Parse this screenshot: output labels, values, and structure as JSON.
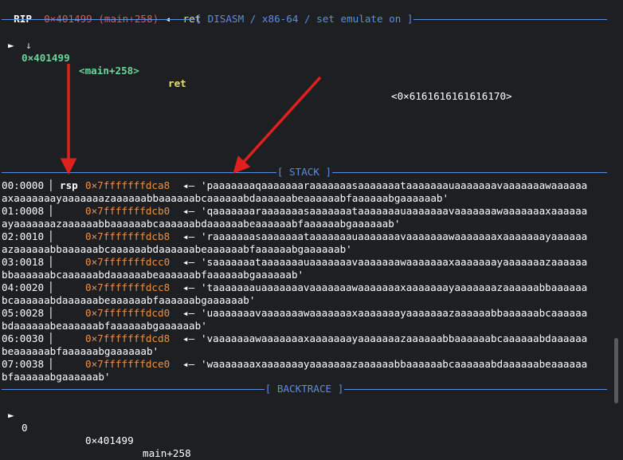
{
  "rip": {
    "label": "RIP",
    "addr": "0×401499 (main+258)",
    "arrow": "◂—",
    "insn": "ret"
  },
  "disasm": {
    "title": "[ DISASM / x86-64 / set emulate on ]",
    "row": {
      "marker": "►",
      "addr": "0×401499",
      "sym": "<main+258>",
      "insn": "ret",
      "target": "<0×6161616161616170>"
    },
    "down_arrow": "↓"
  },
  "stack": {
    "title": "[ STACK ]",
    "rows": [
      {
        "offset": "00:0000",
        "reg": "rsp",
        "addr": "0×7fffffffdca8",
        "arrow": "◂—",
        "value_l1": "'paaaaaaaqaaaaaaaraaaaaaasaaaaaaataaaaaaauaaaaaaavaaaaaaawaaaaaa",
        "value_l2": "axaaaaaaayaaaaaaazaaaaaabbaaaaaabcaaaaaabdaaaaaabeaaaaaabfaaaaaabgaaaaaab'"
      },
      {
        "offset": "01:0008",
        "reg": "",
        "addr": "0×7fffffffdcb0",
        "arrow": "◂—",
        "value_l1": "'qaaaaaaaraaaaaaasaaaaaaataaaaaaauaaaaaaavaaaaaaawaaaaaaaxaaaaaa",
        "value_l2": "ayaaaaaaazaaaaaabbaaaaaabcaaaaaabdaaaaaabeaaaaaabfaaaaaabgaaaaaab'"
      },
      {
        "offset": "02:0010",
        "reg": "",
        "addr": "0×7fffffffdcb8",
        "arrow": "◂—",
        "value_l1": "'raaaaaaasaaaaaaataaaaaaauaaaaaaavaaaaaaawaaaaaaaxaaaaaaayaaaaaa",
        "value_l2": "azaaaaaabbaaaaaabcaaaaaabdaaaaaabeaaaaaabfaaaaaabgaaaaaab'"
      },
      {
        "offset": "03:0018",
        "reg": "",
        "addr": "0×7fffffffdcc0",
        "arrow": "◂—",
        "value_l1": "'saaaaaaataaaaaaauaaaaaaavaaaaaaawaaaaaaaxaaaaaaayaaaaaaazaaaaaa",
        "value_l2": "bbaaaaaabcaaaaaabdaaaaaabeaaaaaabfaaaaaabgaaaaaab'"
      },
      {
        "offset": "04:0020",
        "reg": "",
        "addr": "0×7fffffffdcc8",
        "arrow": "◂—",
        "value_l1": "'taaaaaaauaaaaaaavaaaaaaawaaaaaaaxaaaaaaayaaaaaaazaaaaaabbaaaaaa",
        "value_l2": "bcaaaaaabdaaaaaabeaaaaaabfaaaaaabgaaaaaab'"
      },
      {
        "offset": "05:0028",
        "reg": "",
        "addr": "0×7fffffffdcd0",
        "arrow": "◂—",
        "value_l1": "'uaaaaaaavaaaaaaawaaaaaaaxaaaaaaayaaaaaaazaaaaaabbaaaaaabcaaaaaa",
        "value_l2": "bdaaaaaabeaaaaaabfaaaaaabgaaaaaab'"
      },
      {
        "offset": "06:0030",
        "reg": "",
        "addr": "0×7fffffffdcd8",
        "arrow": "◂—",
        "value_l1": "'vaaaaaaawaaaaaaaxaaaaaaayaaaaaaazaaaaaabbaaaaaabcaaaaaabdaaaaaa",
        "value_l2": "beaaaaaabfaaaaaabgaaaaaab'"
      },
      {
        "offset": "07:0038",
        "reg": "",
        "addr": "0×7fffffffdce0",
        "arrow": "◂—",
        "value_l1": "'waaaaaaaxaaaaaaayaaaaaaazaaaaaabbaaaaaabcaaaaaabdaaaaaabeaaaaaa",
        "value_l2": "bfaaaaaabgaaaaaab'"
      }
    ]
  },
  "backtrace": {
    "title": "[ BACKTRACE ]",
    "row": {
      "marker": "►",
      "idx": "0",
      "addr": "0×401499",
      "sym": "main+258"
    }
  },
  "colors": {
    "background": "#1e1f22",
    "section_line": "#5b8de0",
    "annotation_arrow": "#e0201c",
    "address": "#e3934f"
  }
}
